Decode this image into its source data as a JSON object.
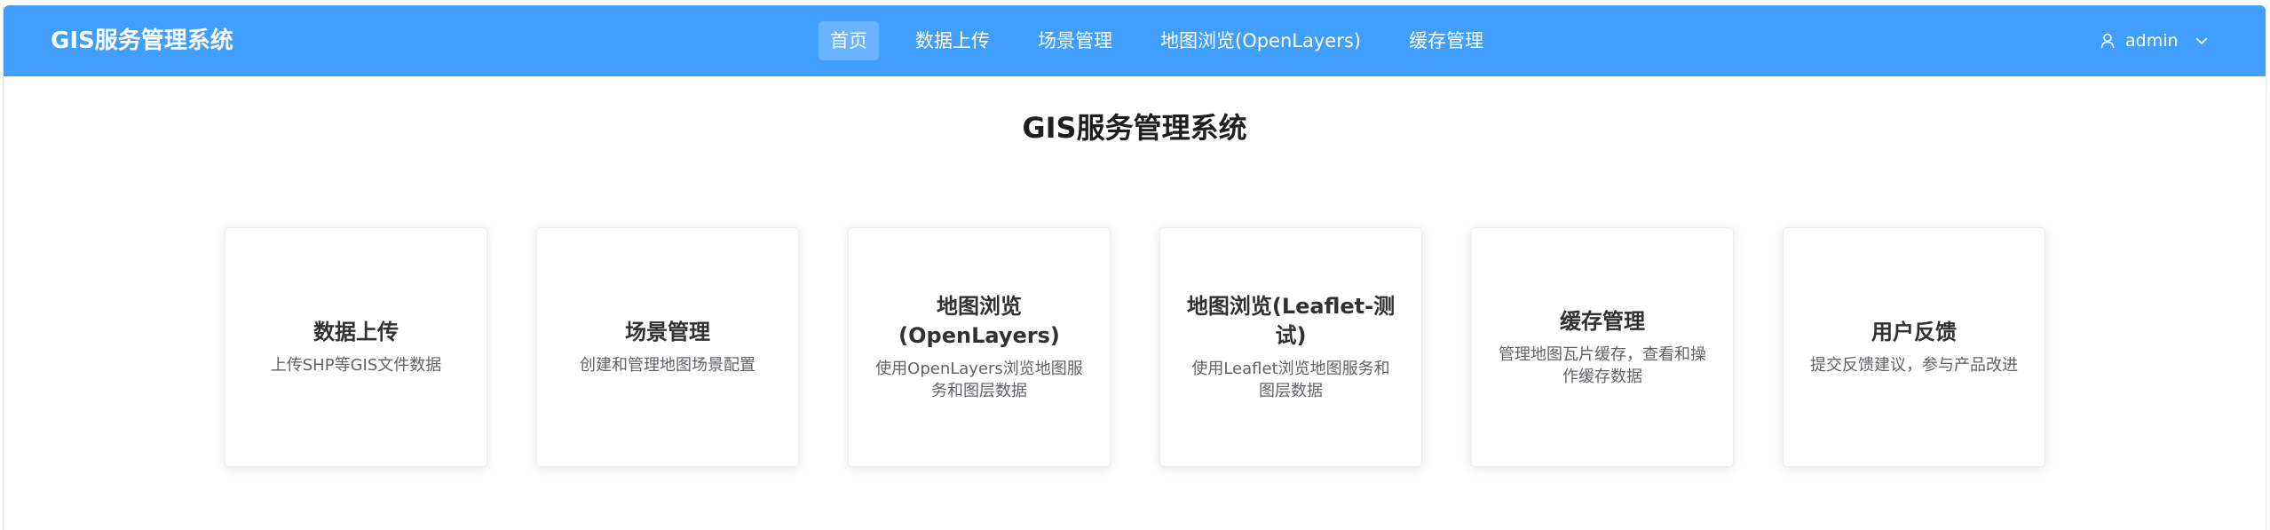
{
  "header": {
    "brand": "GIS服务管理系统",
    "nav": [
      {
        "label": "首页",
        "active": true
      },
      {
        "label": "数据上传",
        "active": false
      },
      {
        "label": "场景管理",
        "active": false
      },
      {
        "label": "地图浏览(OpenLayers)",
        "active": false
      },
      {
        "label": "缓存管理",
        "active": false
      }
    ],
    "user": {
      "name": "admin",
      "icon": "user-icon",
      "dropdown_icon": "chevron-down-icon"
    }
  },
  "main": {
    "title": "GIS服务管理系统",
    "cards": [
      {
        "title": "数据上传",
        "desc": "上传SHP等GIS文件数据"
      },
      {
        "title": "场景管理",
        "desc": "创建和管理地图场景配置"
      },
      {
        "title": "地图浏览(OpenLayers)",
        "desc": "使用OpenLayers浏览地图服务和图层数据"
      },
      {
        "title": "地图浏览(Leaflet-测试)",
        "desc": "使用Leaflet浏览地图服务和图层数据"
      },
      {
        "title": "缓存管理",
        "desc": "管理地图瓦片缓存，查看和操作缓存数据"
      },
      {
        "title": "用户反馈",
        "desc": "提交反馈建议，参与产品改进"
      }
    ]
  },
  "colors": {
    "header_bg": "#409eff",
    "header_text": "#ffffff",
    "title_text": "#1f1f1f",
    "card_title": "#303133",
    "card_desc": "#606266"
  }
}
